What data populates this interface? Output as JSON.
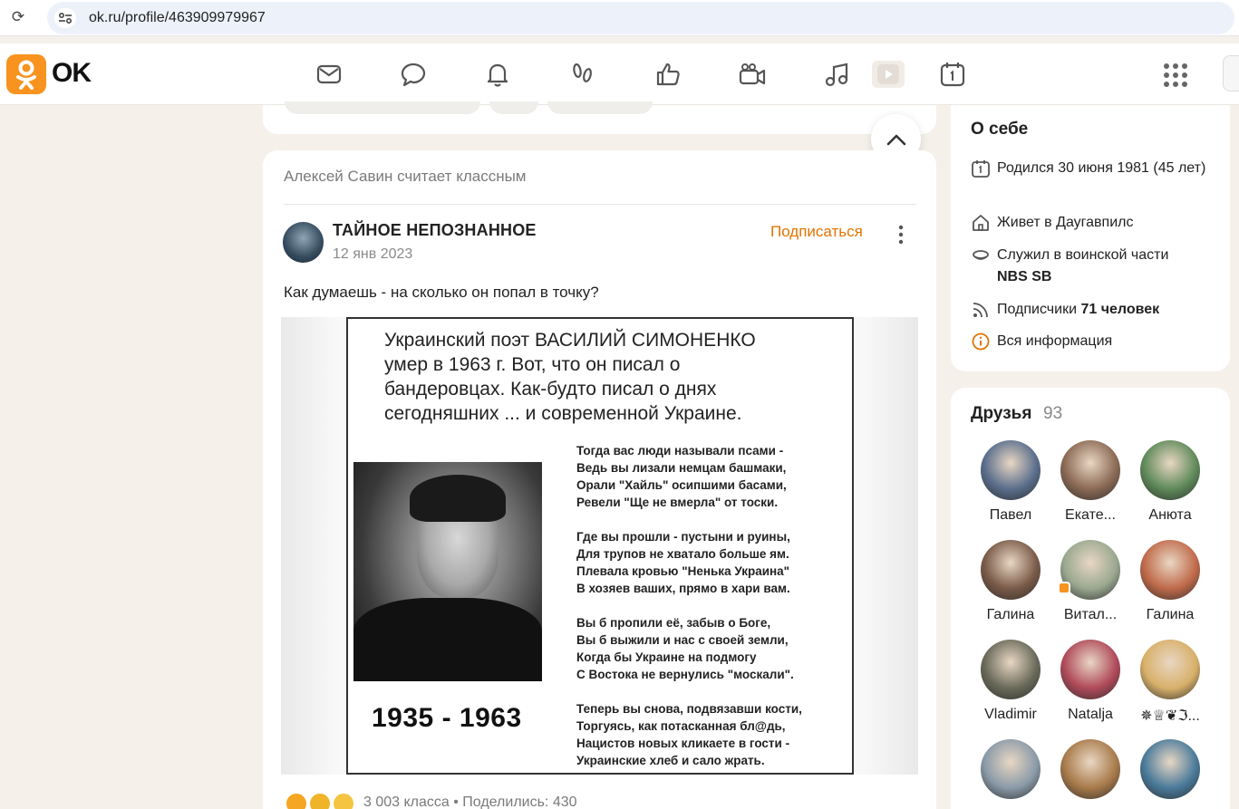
{
  "browser": {
    "url": "ok.ru/profile/463909979967"
  },
  "header": {
    "logo_text": "OK",
    "nav_icons": [
      "mail-icon",
      "chat-icon",
      "bell-icon",
      "footprints-icon",
      "like-icon",
      "video-camera-icon",
      "music-icon",
      "video-icon",
      "calendar-icon"
    ],
    "accent_color": "#f7931e"
  },
  "feed": {
    "context_text": "Алексей Савин считает классным",
    "post": {
      "author": "ТАЙНОЕ НЕПОЗНАННОЕ",
      "date": "12 янв 2023",
      "subscribe_label": "Подписаться",
      "text": "Как думаешь - на сколько он попал в точку?",
      "image": {
        "heading_lines": [
          "Украинский поэт ВАСИЛИЙ СИМОНЕНКО",
          "умер в 1963 г.  Вот, что он писал  о",
          "бандеровцах. Как-будто писал о днях",
          "сегодняшних ...  и современной Украине."
        ],
        "years": "1935 - 1963",
        "stanzas": [
          [
            "Тогда вас люди называли псами -",
            "Ведь вы лизали немцам башмаки,",
            "Орали \"Хайль\" осипшими басами,",
            "Ревели \"Ще не вмерла\" от тоски."
          ],
          [
            "Где вы прошли - пустыни и руины,",
            "Для трупов не хватало больше ям.",
            "Плевала кровью \"Ненька Украина\"",
            "В хозяев ваших, прямо в хари вам."
          ],
          [
            "Вы б пропили её, забыв о Боге,",
            "Вы б выжили и нас с своей земли,",
            "Когда бы Украине на подмогу",
            "С Востока не вернулись \"москали\"."
          ],
          [
            "Теперь вы снова, подвязавши кости,",
            "Торгуясь, как потасканная бл@дь,",
            "Нацистов новых кликаете в гости -",
            "Украинские хлеб и сало жрать."
          ]
        ]
      },
      "stats": "3 003 класса  •  Поделились: 430"
    }
  },
  "about": {
    "title": "О себе",
    "born": "Родился 30 июня 1981 (45 лет)",
    "lives": "Живет в Даугавпилс",
    "served_prefix": "Служил в воинской части",
    "served_unit": "NBS SB",
    "subscribers_prefix": "Подписчики",
    "subscribers_count": "71 человек",
    "all_info": "Вся информация"
  },
  "friends": {
    "title": "Друзья",
    "count": "93",
    "items": [
      {
        "name": "Павел",
        "color": "#5a6e8c"
      },
      {
        "name": "Екате...",
        "color": "#8b6a55"
      },
      {
        "name": "Анюта",
        "color": "#5f8a5a"
      },
      {
        "name": "Галина",
        "color": "#7a5a48"
      },
      {
        "name": "Витал...",
        "color": "#9aa88f"
      },
      {
        "name": "Галина",
        "color": "#c06a4a"
      },
      {
        "name": "Vladimir",
        "color": "#6a6a5a"
      },
      {
        "name": "Natalja",
        "color": "#b04a5a"
      },
      {
        "name": "✵♕❦ℑ...",
        "color": "#d8b06a"
      },
      {
        "name": "",
        "color": "#8a9aa8"
      },
      {
        "name": "",
        "color": "#a87a4a"
      },
      {
        "name": "",
        "color": "#4a7a9a"
      }
    ]
  }
}
